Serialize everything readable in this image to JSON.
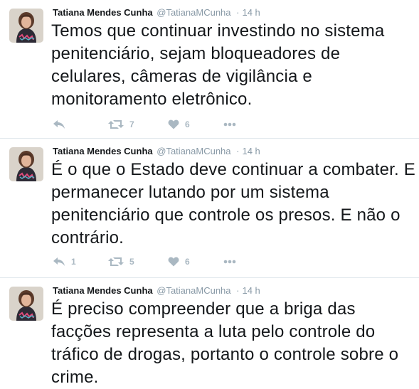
{
  "colors": {
    "text": "#14171a",
    "secondary": "#8899a6",
    "action_icons": "#aab8c2",
    "divider": "#e1e8ed"
  },
  "tweets": [
    {
      "name": "Tatiana Mendes Cunha",
      "handle": "@TatianaMCunha",
      "separator": "·",
      "time": "14 h",
      "text": "Temos que continuar investindo no sistema penitenciário, sejam bloqueadores de celulares, câmeras de vigilância e monitoramento eletrônico.",
      "reply_count": "",
      "retweet_count": "7",
      "like_count": "6"
    },
    {
      "name": "Tatiana Mendes Cunha",
      "handle": "@TatianaMCunha",
      "separator": "·",
      "time": "14 h",
      "text": "É o que o Estado deve continuar a combater. E permanecer lutando por um sistema penitenciário que controle os presos. E não o contrário.",
      "reply_count": "1",
      "retweet_count": "5",
      "like_count": "6"
    },
    {
      "name": "Tatiana Mendes Cunha",
      "handle": "@TatianaMCunha",
      "separator": "·",
      "time": "14 h",
      "text": "É preciso compreender que a briga das facções representa a luta pelo controle do tráfico de drogas, portanto o controle sobre o crime."
    }
  ],
  "icons": {
    "avatar": "avatar",
    "reply": "reply-icon",
    "retweet": "retweet-icon",
    "like": "heart-icon",
    "more": "more-icon"
  }
}
